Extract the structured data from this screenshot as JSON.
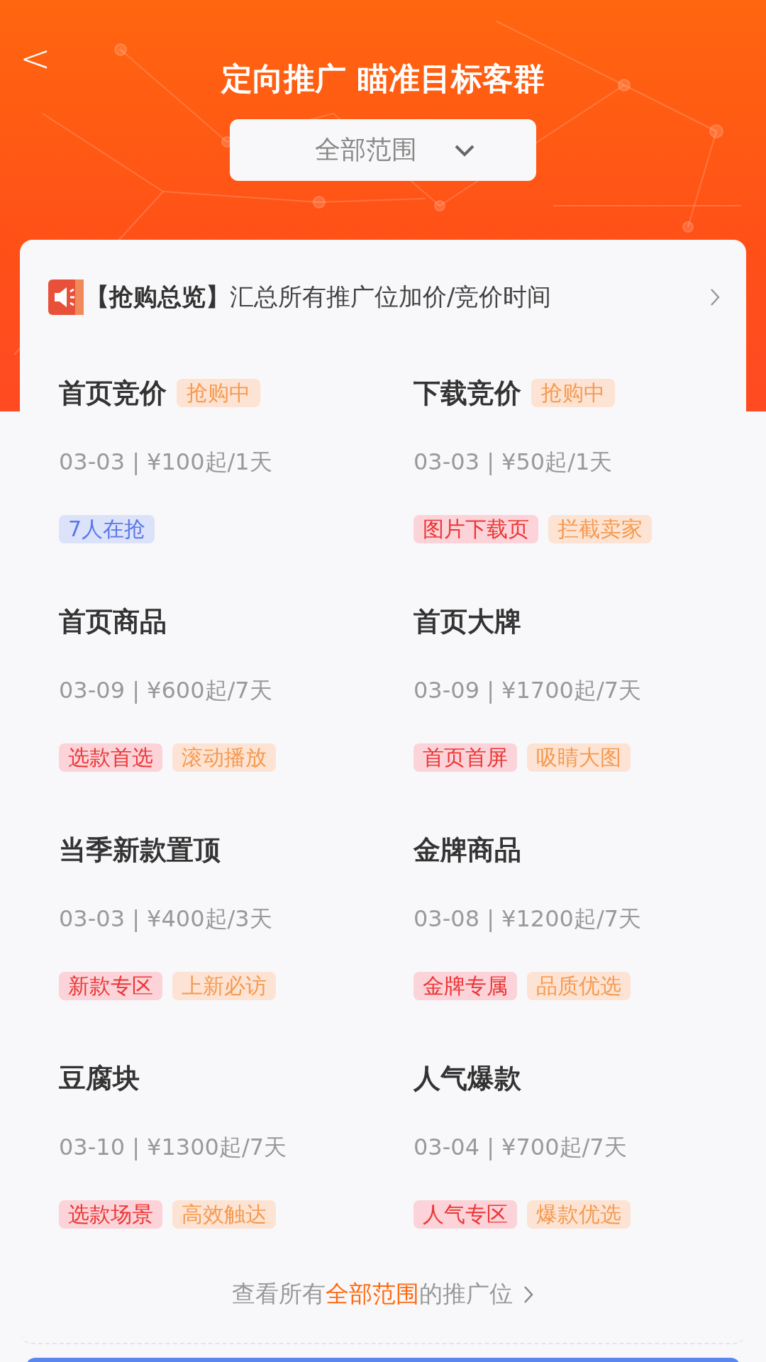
{
  "header": {
    "back": "<",
    "title": "定向推广 瞄准目标客群"
  },
  "scope_dropdown": {
    "value": "全部范围"
  },
  "notice": {
    "text": "**【抢购总览】**汇总所有推广位加价/竞价时间"
  },
  "placements": [
    {
      "name": "首页竞价",
      "status": "抢购中",
      "meta": "03-03 | ¥100起/1天",
      "tags": [
        {
          "text": "7人在抢",
          "kind": "count"
        }
      ]
    },
    {
      "name": "下载竞价",
      "status": "抢购中",
      "meta": "03-03 | ¥50起/1天",
      "tags": [
        {
          "text": "图片下载页",
          "kind": "red"
        },
        {
          "text": "拦截卖家",
          "kind": "orange"
        }
      ]
    },
    {
      "name": "首页商品",
      "meta": "03-09 | ¥600起/7天",
      "tags": [
        {
          "text": "选款首选",
          "kind": "red"
        },
        {
          "text": "滚动播放",
          "kind": "orange"
        }
      ]
    },
    {
      "name": "首页大牌",
      "meta": "03-09 | ¥1700起/7天",
      "tags": [
        {
          "text": "首页首屏",
          "kind": "red"
        },
        {
          "text": "吸睛大图",
          "kind": "orange"
        }
      ]
    },
    {
      "name": "当季新款置顶",
      "meta": "03-03 | ¥400起/3天",
      "tags": [
        {
          "text": "新款专区",
          "kind": "red"
        },
        {
          "text": "上新必访",
          "kind": "orange"
        }
      ]
    },
    {
      "name": "金牌商品",
      "meta": "03-08 | ¥1200起/7天",
      "tags": [
        {
          "text": "金牌专属",
          "kind": "red"
        },
        {
          "text": "品质优选",
          "kind": "orange"
        }
      ]
    },
    {
      "name": "豆腐块",
      "meta": "03-10 | ¥1300起/7天",
      "tags": [
        {
          "text": "选款场景",
          "kind": "red"
        },
        {
          "text": "高效触达",
          "kind": "orange"
        }
      ]
    },
    {
      "name": "人气爆款",
      "meta": "03-04 | ¥700起/7天",
      "tags": [
        {
          "text": "人气专区",
          "kind": "red"
        },
        {
          "text": "爆款优选",
          "kind": "orange"
        }
      ]
    }
  ],
  "view_all": {
    "before": "查看所有",
    "highlight": "全部范围",
    "after": "的推广位"
  }
}
